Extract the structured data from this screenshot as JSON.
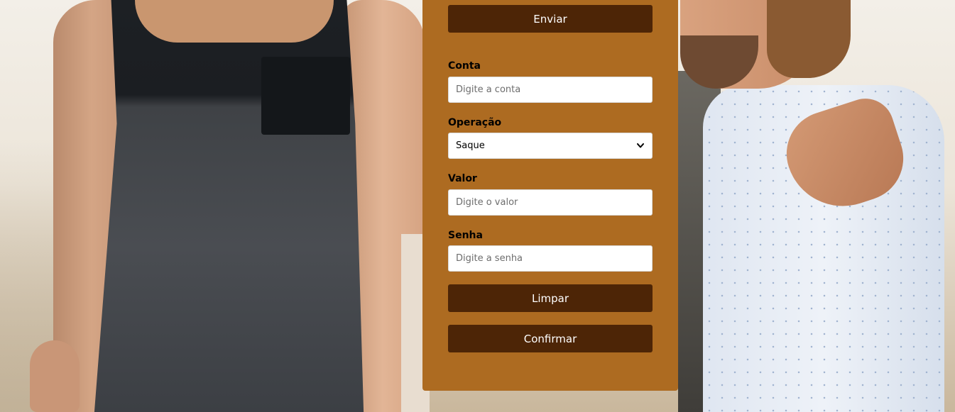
{
  "form": {
    "send_button": "Enviar",
    "account": {
      "label": "Conta",
      "placeholder": "Digite a conta",
      "value": ""
    },
    "operation": {
      "label": "Operação",
      "selected": "Saque"
    },
    "amount": {
      "label": "Valor",
      "placeholder": "Digite o valor",
      "value": ""
    },
    "password": {
      "label": "Senha",
      "placeholder": "Digite a senha",
      "value": ""
    },
    "clear_button": "Limpar",
    "confirm_button": "Confirmar"
  },
  "colors": {
    "panel": "#ad6b21",
    "button": "#4d2506",
    "button_text": "#ffffff"
  },
  "icons": {
    "select_chevron": "chevron-down-icon"
  }
}
